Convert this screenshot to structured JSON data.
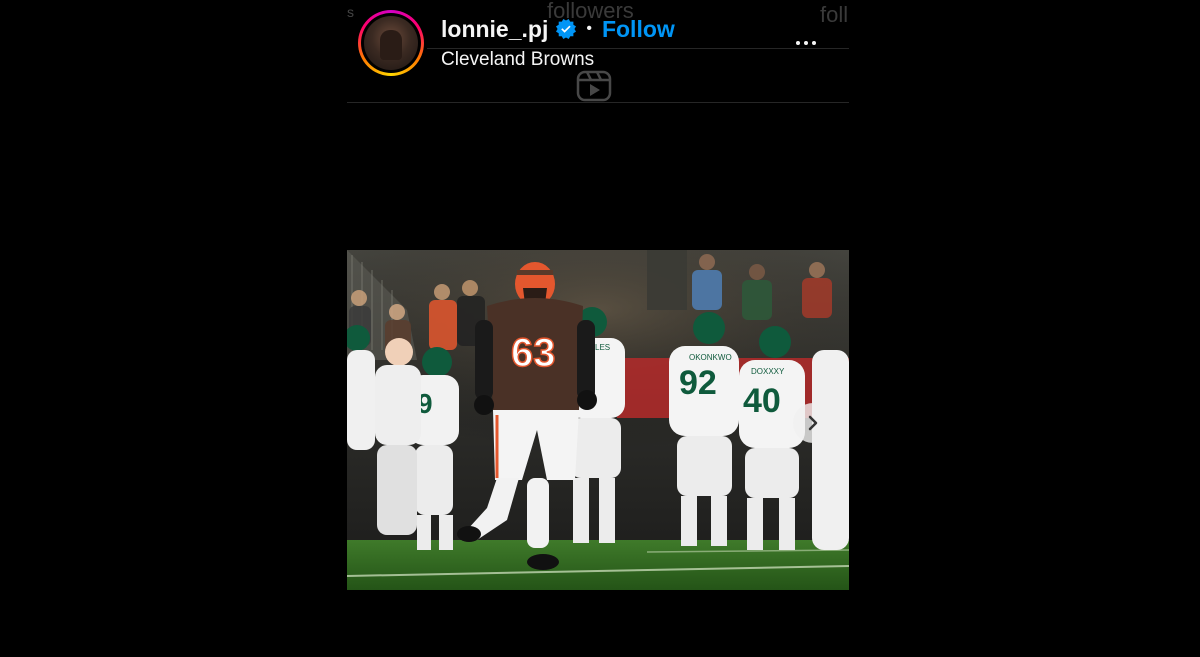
{
  "background_text": {
    "left_fragment": "s",
    "followers": "followers",
    "right_fragment": "foll"
  },
  "post": {
    "username": "lonnie_.pj",
    "verified": true,
    "separator": "•",
    "follow_label": "Follow",
    "location": "Cleveland Browns",
    "image_description_icon": "photo",
    "has_next": true
  },
  "photo_text": {
    "main_jersey": "63",
    "jersey_2": "9",
    "jersey_3": "92",
    "jersey_4": "40",
    "jersey_5": "9",
    "name_3": "OKONKWO",
    "name_4": "DOXXXY",
    "name_2": "HOLES"
  },
  "colors": {
    "follow_blue": "#0095f6",
    "verified_blue": "#0095f6",
    "browns_brown": "#4a3126",
    "browns_orange": "#e4572e",
    "jets_green": "#0f5a3c",
    "field_green": "#2e6b1f"
  },
  "icons": {
    "verified": "verified-badge-icon",
    "more": "more-options-icon",
    "reels": "reels-icon",
    "next": "chevron-right-icon"
  }
}
